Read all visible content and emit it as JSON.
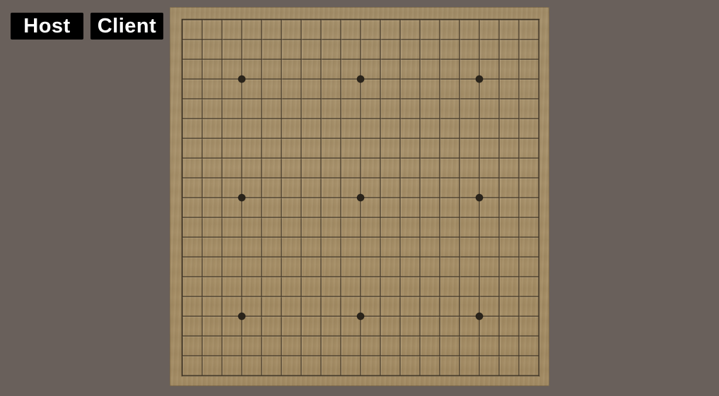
{
  "toolbar": {
    "host_label": "Host",
    "client_label": "Client"
  },
  "board": {
    "size": 19,
    "star_points": [
      [
        3,
        3
      ],
      [
        9,
        3
      ],
      [
        15,
        3
      ],
      [
        3,
        9
      ],
      [
        9,
        9
      ],
      [
        15,
        9
      ],
      [
        3,
        15
      ],
      [
        9,
        15
      ],
      [
        15,
        15
      ]
    ],
    "colors": {
      "background": "#69605b",
      "wood": "#a68f68",
      "line": "#3f3425",
      "star": "#2a241b"
    }
  }
}
